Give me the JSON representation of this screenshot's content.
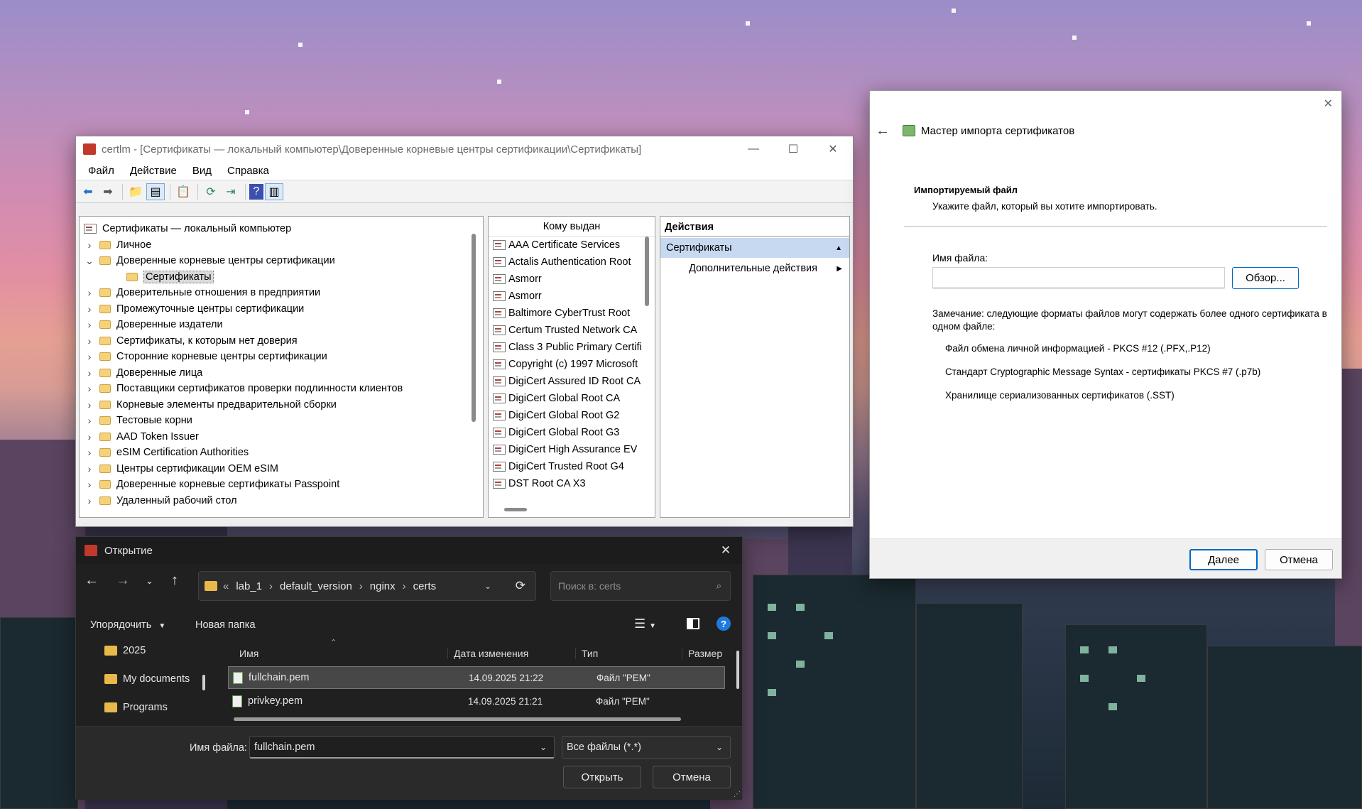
{
  "colors": {
    "accent": "#0067c0",
    "selection": "#cce8ff",
    "action_header": "#c6d9f0"
  },
  "certlm": {
    "title": "certlm - [Сертификаты — локальный компьютер\\Доверенные корневые центры сертификации\\Сертификаты]",
    "menu": [
      "Файл",
      "Действие",
      "Вид",
      "Справка"
    ],
    "tree_root": "Сертификаты — локальный компьютер",
    "tree": [
      {
        "label": "Личное"
      },
      {
        "label": "Доверенные корневые центры сертификации"
      },
      {
        "label": "Сертификаты"
      },
      {
        "label": "Доверительные отношения в предприятии"
      },
      {
        "label": "Промежуточные центры сертификации"
      },
      {
        "label": "Доверенные издатели"
      },
      {
        "label": "Сертификаты, к которым нет доверия"
      },
      {
        "label": "Сторонние корневые центры сертификации"
      },
      {
        "label": "Доверенные лица"
      },
      {
        "label": "Поставщики сертификатов проверки подлинности клиентов"
      },
      {
        "label": "Корневые элементы предварительной сборки"
      },
      {
        "label": "Тестовые корни"
      },
      {
        "label": "AAD Token Issuer"
      },
      {
        "label": "eSIM Certification Authorities"
      },
      {
        "label": "Центры сертификации OEM eSIM"
      },
      {
        "label": "Доверенные корневые сертификаты Passpoint"
      },
      {
        "label": "Удаленный рабочий стол"
      }
    ],
    "list_header": "Кому выдан",
    "certs": [
      "AAA Certificate Services",
      "Actalis Authentication Root",
      "Asmorr",
      "Asmorr",
      "Baltimore CyberTrust Root",
      "Certum Trusted Network CA",
      "Class 3 Public Primary Certifi",
      "Copyright (c) 1997 Microsoft",
      "DigiCert Assured ID Root CA",
      "DigiCert Global Root CA",
      "DigiCert Global Root G2",
      "DigiCert Global Root G3",
      "DigiCert High Assurance EV",
      "DigiCert Trusted Root G4",
      "DST Root CA X3"
    ],
    "actions_header": "Действия",
    "actions_section": "Сертификаты",
    "actions_more": "Дополнительные действия"
  },
  "wizard": {
    "title": "Мастер импорта сертификатов",
    "heading": "Импортируемый файл",
    "subheading": "Укажите файл, который вы хотите импортировать.",
    "filename_label": "Имя файла:",
    "filename_value": "",
    "browse": "Обзор...",
    "note": "Замечание: следующие форматы файлов могут содержать более одного сертификата в одном файле:",
    "formats": [
      "Файл обмена личной информацией - PKCS #12 (.PFX,.P12)",
      "Стандарт Cryptographic Message Syntax - сертификаты PKCS #7 (.p7b)",
      "Хранилище сериализованных сертификатов (.SST)"
    ],
    "next": "Далее",
    "cancel": "Отмена"
  },
  "open_dialog": {
    "title": "Открытие",
    "breadcrumb": [
      "lab_1",
      "default_version",
      "nginx",
      "certs"
    ],
    "search_placeholder": "Поиск в: certs",
    "organize": "Упорядочить",
    "new_folder": "Новая папка",
    "sidebar": [
      "2025",
      "My documents",
      "Programs"
    ],
    "columns": [
      "Имя",
      "Дата изменения",
      "Тип",
      "Размер"
    ],
    "files": [
      {
        "name": "fullchain.pem",
        "date": "14.09.2025 21:22",
        "type": "Файл \"PEM\""
      },
      {
        "name": "privkey.pem",
        "date": "14.09.2025 21:21",
        "type": "Файл \"PEM\""
      }
    ],
    "filename_label": "Имя файла:",
    "filename_value": "fullchain.pem",
    "filter": "Все файлы (*.*)",
    "open": "Открыть",
    "cancel": "Отмена"
  }
}
